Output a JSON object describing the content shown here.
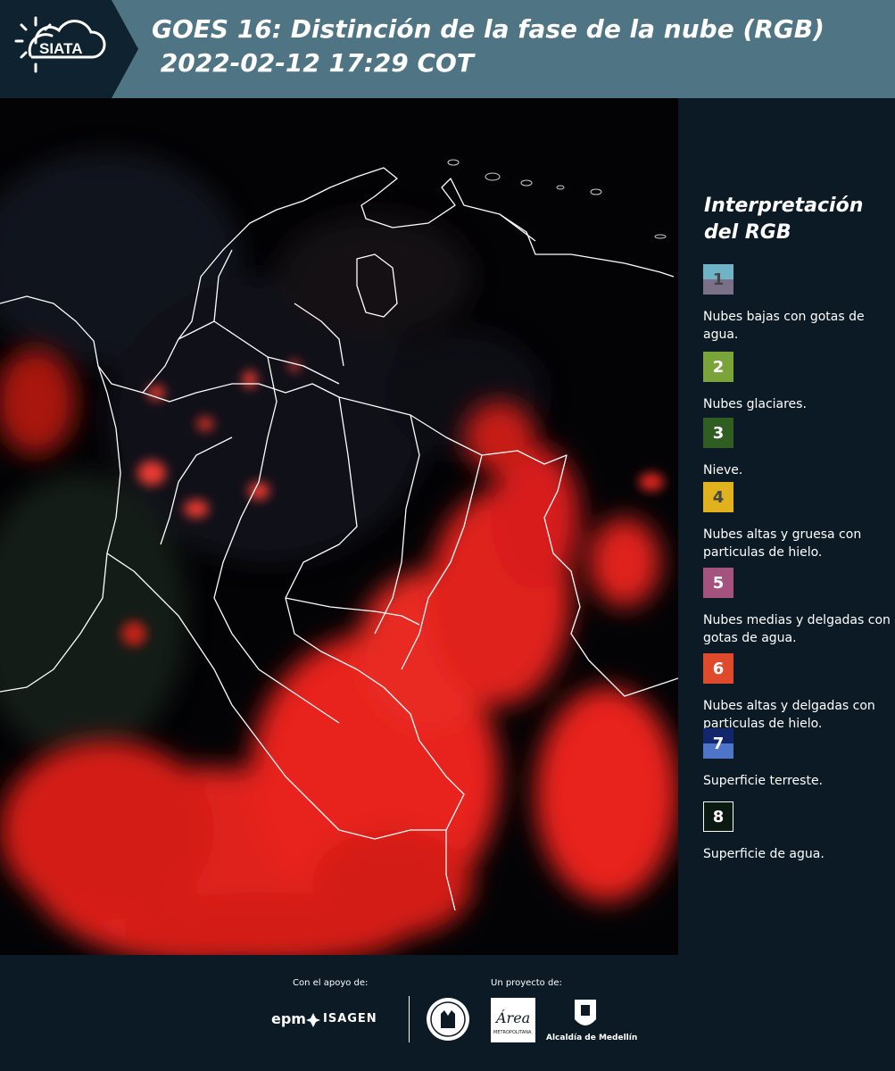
{
  "header": {
    "logo_text": "SIATA",
    "title_line1": "GOES 16: Distinción de la fase de la nube (RGB)",
    "title_line2": " 2022-02-12 17:29 COT"
  },
  "legend": {
    "title": "Interpretación del RGB",
    "items": [
      {
        "number": "1",
        "label": "Nubes bajas con gotas de agua.",
        "color_top": "#6fb3c6",
        "color_bottom": "#7a7088",
        "text_color": "#444444"
      },
      {
        "number": "2",
        "label": "Nubes glaciares.",
        "color_top": "#7aa33a",
        "color_bottom": "#7aa33a",
        "text_color": "#ffffff"
      },
      {
        "number": "3",
        "label": "Nieve.",
        "color_top": "#2f5d22",
        "color_bottom": "#2f5d22",
        "text_color": "#ffffff"
      },
      {
        "number": "4",
        "label": "Nubes altas y gruesa con particulas de hielo.",
        "color_top": "#e0b21e",
        "color_bottom": "#e0b21e",
        "text_color": "#444444"
      },
      {
        "number": "5",
        "label": "Nubes medias y delgadas con gotas de agua.",
        "color_top": "#a3537e",
        "color_bottom": "#a3537e",
        "text_color": "#ffffff"
      },
      {
        "number": "6",
        "label": "Nubes altas y delgadas con particulas de hielo.",
        "color_top": "#e04a2c",
        "color_bottom": "#e04a2c",
        "text_color": "#ffffff"
      },
      {
        "number": "7",
        "label": "Superficie terreste.",
        "color_top": "#12276b",
        "color_bottom": "#4f75c9",
        "text_color": "#ffffff"
      },
      {
        "number": "8",
        "label": "Superficie de agua.",
        "color_top": "#0a1a12",
        "color_bottom": "#0a1a12",
        "text_color": "#ffffff"
      }
    ]
  },
  "footer": {
    "support_label": "Con el apoyo de:",
    "project_label": "Un proyecto de:",
    "epm": "epm",
    "isagen": "ISAGEN",
    "alcaldia": "Alcaldía de Medellín",
    "area_script": "Área",
    "area_sub": "METROPOLITANA"
  }
}
